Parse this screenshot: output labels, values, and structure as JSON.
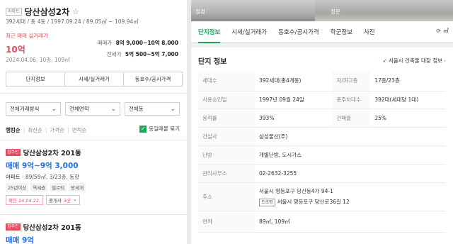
{
  "left": {
    "type_badge": "아파트",
    "title": "당산삼성2차",
    "summary": "392세대 / 총 4동 / 1997.09.24 / 89.05㎡ ~ 109.94㎡",
    "recent": {
      "label": "최근 매매 실거래가",
      "price": "10억",
      "date": "2024.04.06, 10층, 109㎡"
    },
    "prices": [
      {
        "label": "매매가",
        "value": "8억 9,000~10억 8,000"
      },
      {
        "label": "전세가",
        "value": "5억 500~5억 7,000"
      }
    ],
    "tabs": [
      "단지정보",
      "시세/실거래가",
      "동호수/공시가격"
    ],
    "filters": [
      "전체거래방식",
      "전체면적",
      "전체동"
    ],
    "sort": [
      "랭킹순",
      "최신순",
      "가격순",
      "면적순"
    ],
    "same_listing_label": "동일매물 묶기",
    "items": [
      {
        "owner_badge": "집주인",
        "name": "당산삼성2차 201동",
        "price": "매매 9억~9억 3,000",
        "spec_type": "아파트",
        "spec_rest": " · 89/59㎡, 3/23층, 동향",
        "tags": [
          "25년이상",
          "역세권",
          "필로티",
          "방세개"
        ],
        "confirm": "확인 24.04.22.",
        "agent_label": "중개사",
        "agent_count": "3곳"
      },
      {
        "owner_badge": "집주인",
        "name": "당산삼성2차 201동",
        "price": "매매 9억"
      }
    ]
  },
  "right": {
    "photo_labels": [
      "정경",
      "정문"
    ],
    "tabs": [
      "단지정보",
      "시세/실거래가",
      "동호수/공시가격",
      "학군정보",
      "사진"
    ],
    "refresh_label": "㎡",
    "section_title": "단지 정보",
    "bldg_link": "서울시 건축물 대장 정보",
    "rows": [
      {
        "k": "세대수",
        "v": "392세대(총4개동)",
        "k2": "저/최고층",
        "v2": "17층/23층"
      },
      {
        "k": "사용승인일",
        "v": "1997년 09월 24일",
        "k2": "총주차대수",
        "v2": "392대(세대당 1대)"
      },
      {
        "k": "용적률",
        "v": "393%",
        "k2": "건폐율",
        "v2": "25%"
      },
      {
        "k": "건설사",
        "v": "삼성물산(주)"
      },
      {
        "k": "난방",
        "v": "개별난방, 도시가스"
      },
      {
        "k": "관리사무소",
        "v": "02-2632-3255"
      },
      {
        "k": "주소",
        "v": "서울시 영등포구 당산동4가 94-1",
        "road_badge": "도로명",
        "road": "서울시 영등포구 당산로36길 12"
      },
      {
        "k": "면적",
        "v": "89㎡, 109㎡"
      }
    ]
  }
}
